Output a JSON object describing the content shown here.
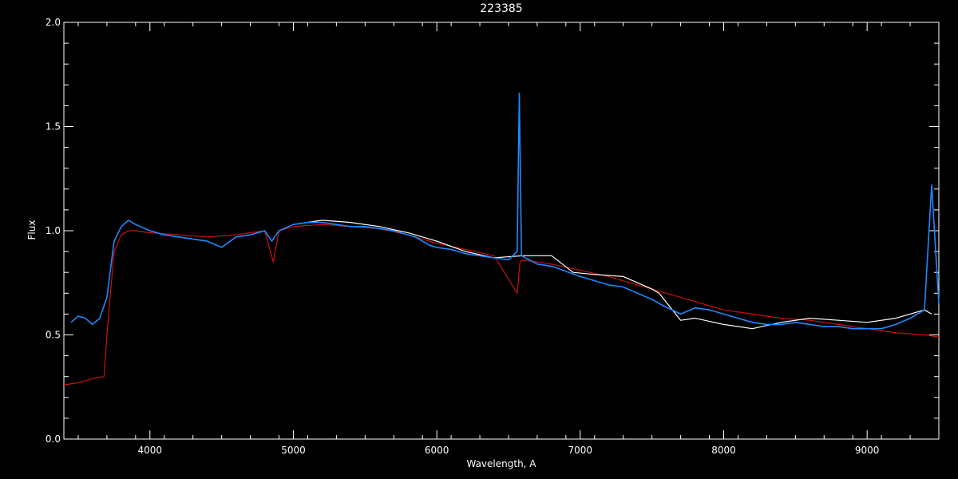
{
  "chart_data": {
    "type": "line",
    "title": "223385",
    "xlabel": "Wavelength, A",
    "ylabel": "Flux",
    "xlim": [
      3400,
      9500
    ],
    "ylim": [
      0,
      2.0
    ],
    "xticks": [
      4000,
      5000,
      6000,
      7000,
      8000,
      9000
    ],
    "xtick_labels": [
      "4000",
      "5000",
      "6000",
      "7000",
      "8000",
      "9000"
    ],
    "yticks": [
      0,
      0.5,
      1.0,
      1.5,
      2.0
    ],
    "ytick_labels": [
      "0.0",
      "0.5",
      "1.0",
      "1.5",
      "2.0"
    ],
    "grid": false,
    "legend": "none",
    "colors": {
      "background": "#000000",
      "axes": "#ffffff",
      "model": "#cc1111",
      "observed": "#ffffff",
      "observed2": "#1e88ff"
    },
    "series": [
      {
        "color": "#cc1111",
        "x": [
          3400,
          3500,
          3600,
          3680,
          3700,
          3750,
          3800,
          3850,
          3900,
          4000,
          4200,
          4400,
          4600,
          4800,
          4860,
          4900,
          5000,
          5200,
          5400,
          5600,
          5800,
          5900,
          6000,
          6200,
          6400,
          6560,
          6580,
          6600,
          6800,
          7000,
          7200,
          7400,
          7600,
          7800,
          8000,
          8200,
          8400,
          8600,
          8800,
          9000,
          9200,
          9400,
          9500
        ],
        "y": [
          0.26,
          0.27,
          0.29,
          0.3,
          0.5,
          0.9,
          0.98,
          1.0,
          1.0,
          0.99,
          0.98,
          0.97,
          0.98,
          1.0,
          0.85,
          1.0,
          1.02,
          1.03,
          1.02,
          1.01,
          0.98,
          0.96,
          0.94,
          0.91,
          0.88,
          0.7,
          0.85,
          0.86,
          0.84,
          0.81,
          0.78,
          0.74,
          0.7,
          0.66,
          0.62,
          0.6,
          0.58,
          0.57,
          0.55,
          0.53,
          0.51,
          0.5,
          0.49
        ]
      },
      {
        "color": "#ffffff",
        "x": [
          5000,
          5200,
          5400,
          5600,
          5800,
          6000,
          6200,
          6400,
          6600,
          6800,
          6950,
          7100,
          7300,
          7500,
          7550,
          7700,
          7800,
          8000,
          8200,
          8400,
          8600,
          8800,
          9000,
          9200,
          9400,
          9450
        ],
        "y": [
          1.03,
          1.05,
          1.04,
          1.02,
          0.99,
          0.95,
          0.9,
          0.87,
          0.88,
          0.88,
          0.8,
          0.79,
          0.78,
          0.72,
          0.7,
          0.57,
          0.58,
          0.55,
          0.53,
          0.56,
          0.58,
          0.57,
          0.56,
          0.58,
          0.62,
          0.6
        ]
      },
      {
        "color": "#1e88ff",
        "x": [
          3450,
          3500,
          3550,
          3600,
          3650,
          3700,
          3750,
          3800,
          3850,
          3900,
          4000,
          4100,
          4200,
          4300,
          4400,
          4500,
          4600,
          4700,
          4800,
          4850,
          4900,
          5000,
          5100,
          5200,
          5300,
          5400,
          5500,
          5600,
          5700,
          5800,
          5850,
          5900,
          5950,
          6000,
          6100,
          6200,
          6300,
          6400,
          6500,
          6560,
          6575,
          6590,
          6700,
          6800,
          7000,
          7100,
          7200,
          7300,
          7400,
          7500,
          7580,
          7700,
          7800,
          7900,
          8000,
          8100,
          8200,
          8300,
          8400,
          8500,
          8600,
          8700,
          8800,
          8900,
          9000,
          9100,
          9200,
          9300,
          9400,
          9450,
          9500
        ],
        "y": [
          0.56,
          0.59,
          0.58,
          0.55,
          0.58,
          0.68,
          0.95,
          1.02,
          1.05,
          1.03,
          1.0,
          0.98,
          0.97,
          0.96,
          0.95,
          0.92,
          0.97,
          0.98,
          1.0,
          0.95,
          1.0,
          1.03,
          1.04,
          1.04,
          1.03,
          1.02,
          1.02,
          1.01,
          1.0,
          0.98,
          0.97,
          0.95,
          0.93,
          0.92,
          0.91,
          0.89,
          0.88,
          0.87,
          0.86,
          0.9,
          1.66,
          0.88,
          0.84,
          0.83,
          0.78,
          0.76,
          0.74,
          0.73,
          0.7,
          0.67,
          0.64,
          0.6,
          0.63,
          0.62,
          0.6,
          0.58,
          0.56,
          0.55,
          0.55,
          0.56,
          0.55,
          0.54,
          0.54,
          0.53,
          0.53,
          0.53,
          0.55,
          0.58,
          0.62,
          1.22,
          0.65
        ]
      }
    ]
  }
}
